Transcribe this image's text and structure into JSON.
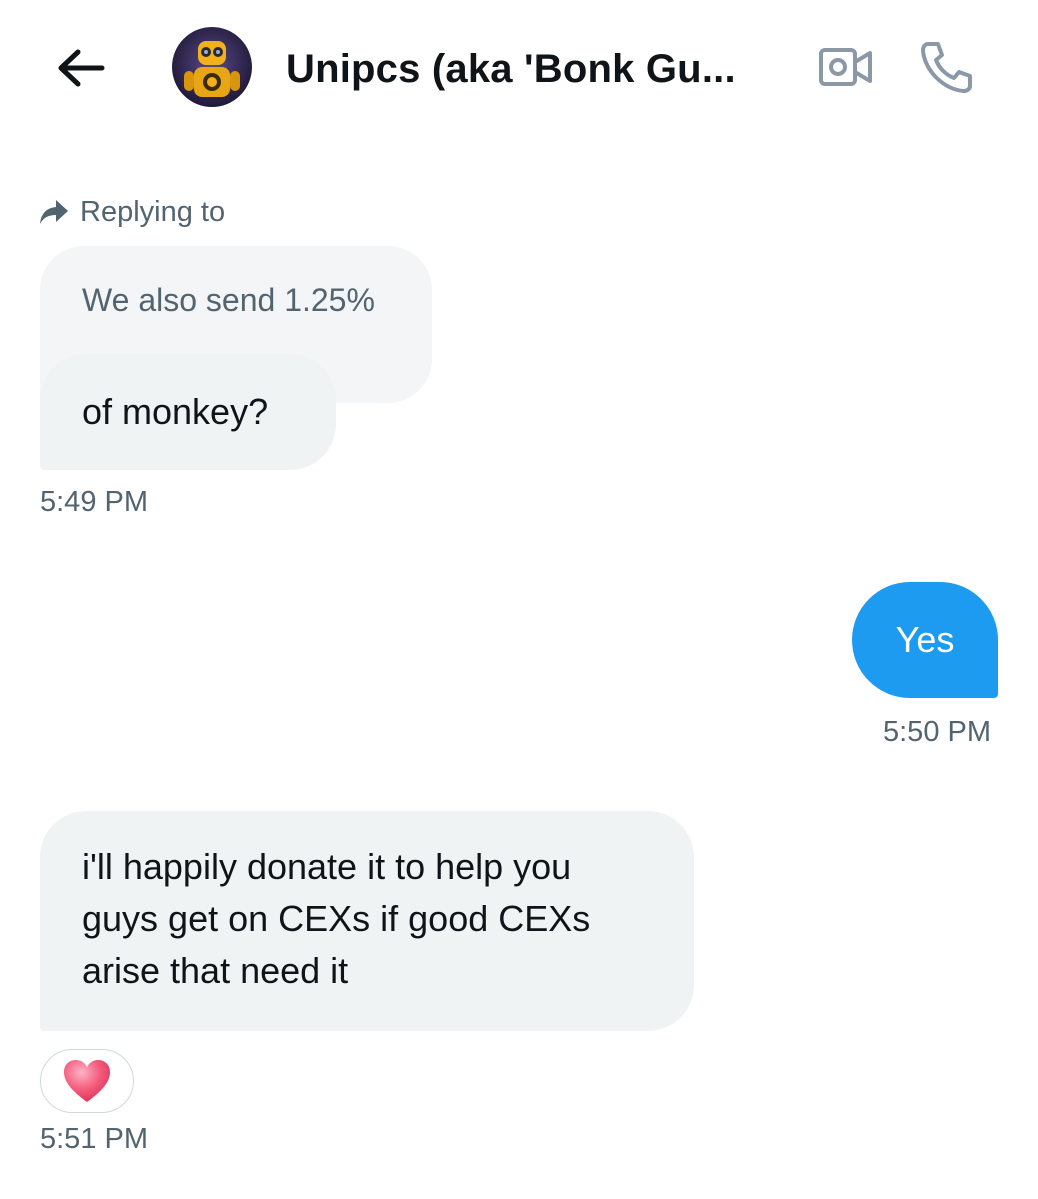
{
  "header": {
    "title": "Unipcs (aka 'Bonk Gu...",
    "back_icon": "arrow-left-icon",
    "video_icon": "video-camera-icon",
    "call_icon": "phone-icon"
  },
  "conversation": {
    "reply_context": {
      "label": "Replying to",
      "quoted_text": "We also send 1.25%"
    },
    "messages": [
      {
        "direction": "incoming",
        "text": "of monkey?",
        "time": "5:49 PM"
      },
      {
        "direction": "outgoing",
        "text": "Yes",
        "time": "5:50 PM"
      },
      {
        "direction": "incoming",
        "text": "i'll happily donate it to help you guys get on CEXs if good CEXs arise that need it",
        "time": "5:51 PM",
        "reaction": "heart"
      }
    ]
  },
  "colors": {
    "outgoing_bubble": "#1d9bf0",
    "incoming_bubble": "#eff3f4",
    "secondary_text": "#536471"
  }
}
